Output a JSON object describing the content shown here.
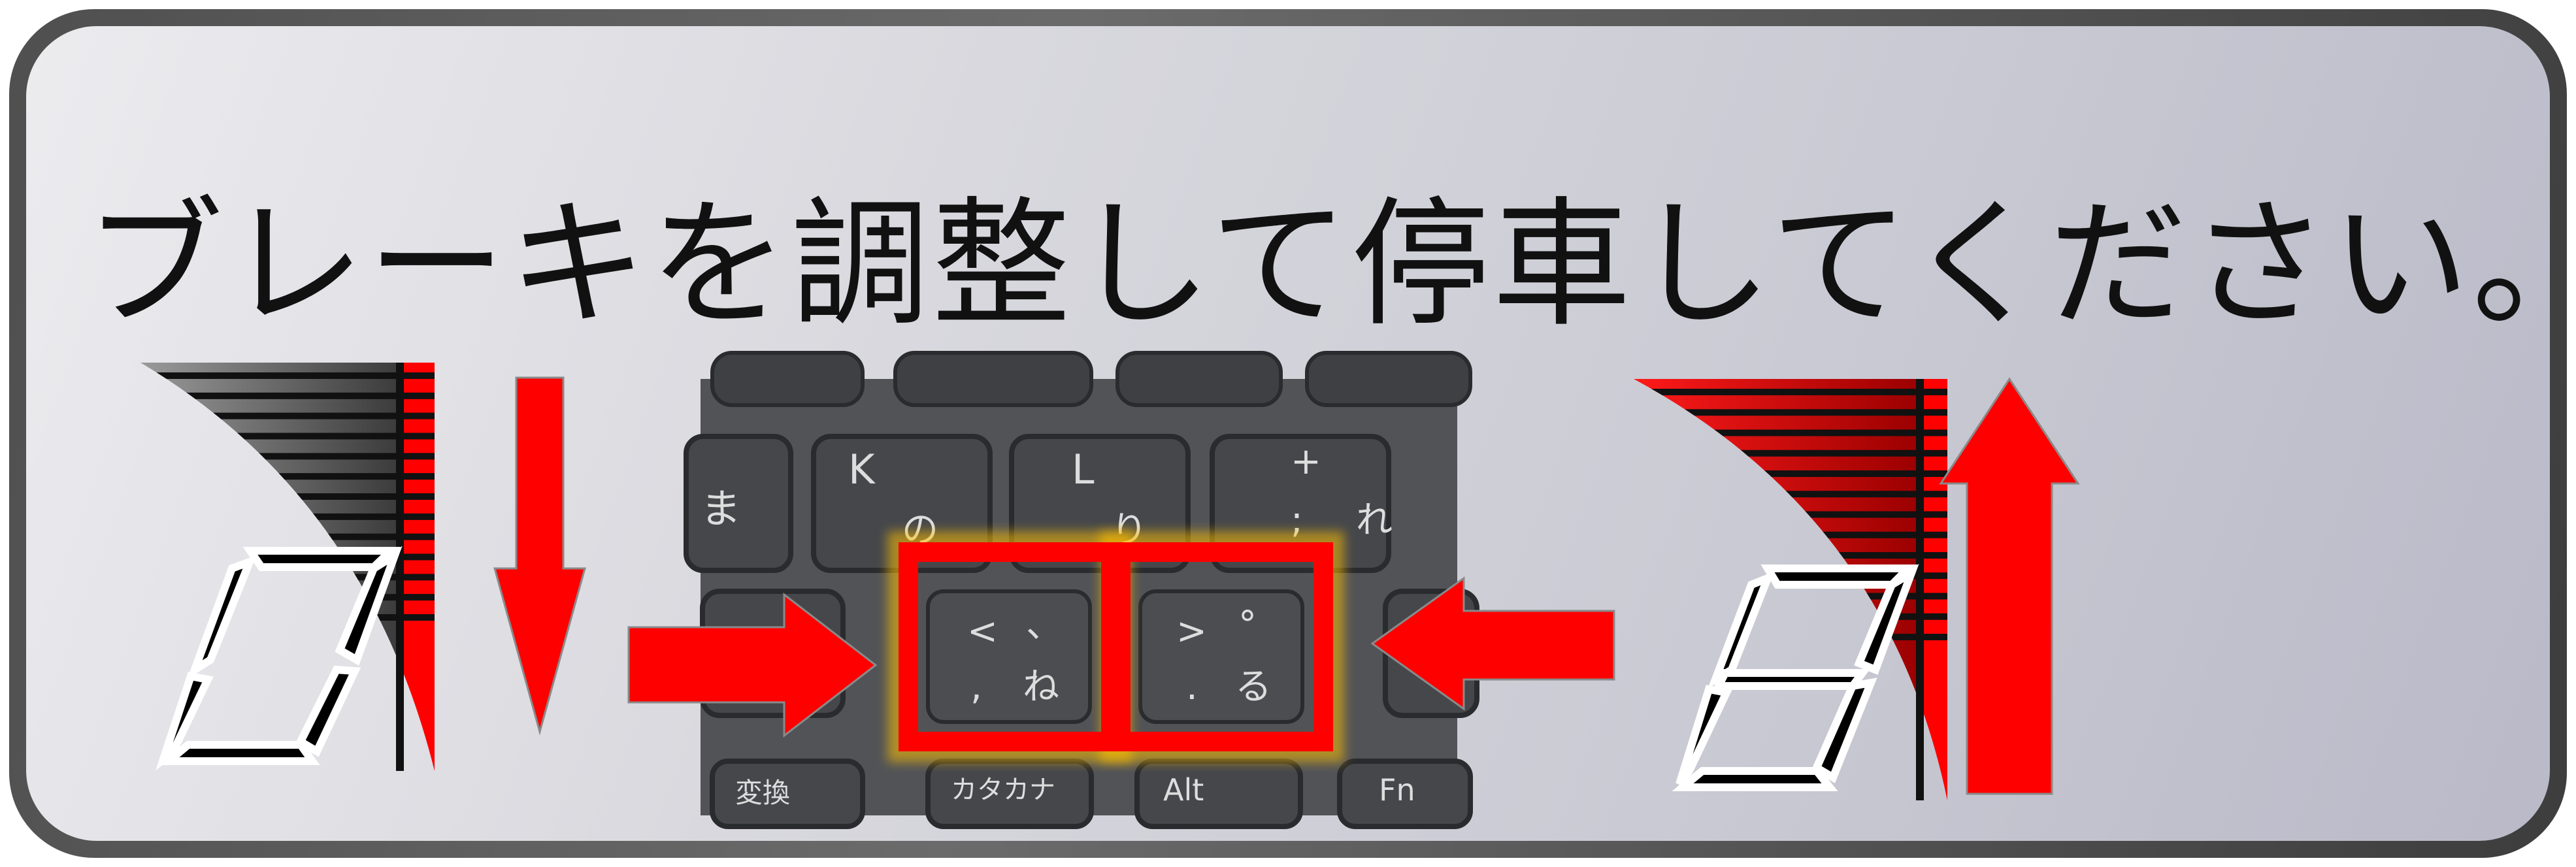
{
  "instruction_text": "ブレーキを調整して停車してください。",
  "left_gauge": {
    "digit": "0",
    "level_fraction": 0.0,
    "color": "#ff0000"
  },
  "right_gauge": {
    "digit": "8",
    "level_fraction": 1.0,
    "color": "#e00000"
  },
  "keyboard": {
    "keys_row1": [
      {
        "name": "key-ma",
        "label": "ま"
      },
      {
        "name": "key-k",
        "label": "K",
        "kana": "の"
      },
      {
        "name": "key-l",
        "label": "L",
        "kana": "り"
      },
      {
        "name": "key-plus",
        "label": "+",
        "sub": ";",
        "kana": "れ"
      }
    ],
    "key_comma": {
      "top": "<",
      "top_kana": "、",
      "bottom": ",",
      "bottom_kana": "ね"
    },
    "key_period": {
      "top": ">",
      "top_kana": "°",
      "bottom": ".",
      "bottom_kana": "る"
    },
    "keys_bottom": [
      {
        "name": "key-henkan",
        "label": "変換"
      },
      {
        "name": "key-katakana",
        "label": "カタカナ"
      },
      {
        "name": "key-alt",
        "label": "Alt"
      },
      {
        "name": "key-fn",
        "label": "Fn"
      }
    ],
    "highlight_color": "#ff0000"
  }
}
